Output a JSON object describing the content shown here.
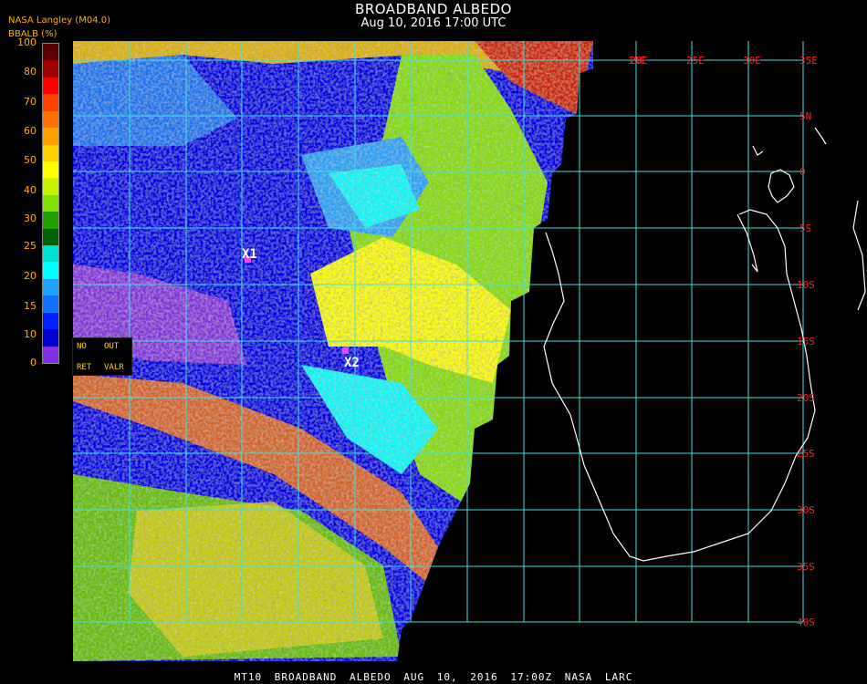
{
  "header": {
    "title": "BROADBAND ALBEDO",
    "subtitle": "Aug 10, 2016 17:00 UTC",
    "producer": "NASA Langley (M04.0)",
    "units": "BBALB (%)"
  },
  "colorbar": {
    "ticks": [
      "100",
      "80",
      "70",
      "60",
      "50",
      "40",
      "30",
      "25",
      "20",
      "15",
      "10",
      "0"
    ],
    "bands": [
      {
        "range": "90-100",
        "color": "#5a0000"
      },
      {
        "range": "80-90",
        "color": "#a00000"
      },
      {
        "range": "70-80",
        "color": "#ff0000"
      },
      {
        "range": "65-70",
        "color": "#ff4000"
      },
      {
        "range": "60-65",
        "color": "#ff7000"
      },
      {
        "range": "55-60",
        "color": "#ffa000"
      },
      {
        "range": "50-55",
        "color": "#ffd000"
      },
      {
        "range": "45-50",
        "color": "#ffff00"
      },
      {
        "range": "40-45",
        "color": "#c8f000"
      },
      {
        "range": "35-40",
        "color": "#80e000"
      },
      {
        "range": "30-35",
        "color": "#20a000"
      },
      {
        "range": "25-30",
        "color": "#006000"
      },
      {
        "range": "22-25",
        "color": "#00e0d0"
      },
      {
        "range": "20-22",
        "color": "#00ffff"
      },
      {
        "range": "17-20",
        "color": "#20a0ff"
      },
      {
        "range": "15-17",
        "color": "#1070ff"
      },
      {
        "range": "12-15",
        "color": "#0020ff"
      },
      {
        "range": "10-12",
        "color": "#0000d0"
      },
      {
        "range": "0-10",
        "color": "#8030e0"
      }
    ]
  },
  "legend": {
    "no": "NO",
    "out": "OUT",
    "ret": "RET",
    "valr": "VALR"
  },
  "lon_labels": [
    "15E",
    "20E",
    "25E",
    "30E",
    "35E"
  ],
  "lat_labels": [
    "5N",
    "0",
    "5S",
    "10S",
    "15S",
    "20S",
    "25S",
    "30S",
    "35S",
    "40S"
  ],
  "markers": [
    {
      "label": "X1",
      "color": "#ff40ff"
    },
    {
      "label": "X2",
      "color": "#ff40ff"
    }
  ],
  "footer": "MT10 BROADBAND ALBEDO AUG 10, 2016 17:00Z NASA LARC",
  "colors": {
    "grid": "#40e0e0",
    "coast": "#ffffff",
    "labels": "#ff2020",
    "accent": "#ffb000"
  }
}
